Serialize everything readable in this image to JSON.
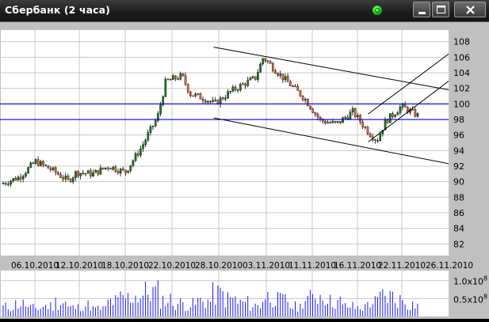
{
  "window": {
    "title": "Сбербанк (2 часа)",
    "status_indicator_color": "#2fd12f",
    "buttons": [
      "minimize-icon",
      "maximize-icon",
      "close-icon"
    ]
  },
  "colors": {
    "plot_background": "#ffffff",
    "panel_background": "#c0c0c0",
    "grid": "#c8c8c8",
    "up_candle": "#1e7b1e",
    "down_candle": "#e8663a",
    "support_lines": "#0000cc",
    "trend_lines": "#000000",
    "volume_bars": "#1a1aff"
  },
  "chart_data": [
    {
      "type": "candlestick",
      "y_axis": {
        "ticks": [
          "82",
          "84",
          "86",
          "88",
          "90",
          "92",
          "94",
          "96",
          "98",
          "100",
          "102",
          "104",
          "106",
          "108"
        ],
        "range": [
          80.5,
          109.5
        ],
        "position": "right"
      },
      "x_axis": {
        "tick_labels": [
          "06.10.2010",
          "12.10.2010",
          "18.10.2010",
          "22.10.2010",
          "28.10.2010",
          "03.11.2010",
          "11.11.2010",
          "16.11.2010",
          "22.11.2010",
          "26.11.2010"
        ]
      },
      "grid": true,
      "horizontal_lines": [
        100.0,
        98.0
      ],
      "close_path_approx": [
        {
          "date": "02.10.2010",
          "close": 89.8
        },
        {
          "date": "04.10.2010",
          "close": 90.6
        },
        {
          "date": "06.10.2010",
          "close": 92.6
        },
        {
          "date": "08.10.2010",
          "close": 91.5
        },
        {
          "date": "10.10.2010",
          "close": 90.1
        },
        {
          "date": "11.10.2010",
          "close": 91.2
        },
        {
          "date": "13.10.2010",
          "close": 91.0
        },
        {
          "date": "15.10.2010",
          "close": 92.0
        },
        {
          "date": "17.10.2010",
          "close": 91.2
        },
        {
          "date": "19.10.2010",
          "close": 94.4
        },
        {
          "date": "20.10.2010",
          "close": 96.4
        },
        {
          "date": "21.10.2010",
          "close": 98.3
        },
        {
          "date": "22.10.2010",
          "close": 102.9
        },
        {
          "date": "24.10.2010",
          "close": 103.6
        },
        {
          "date": "25.10.2010",
          "close": 101.3
        },
        {
          "date": "27.10.2010",
          "close": 100.6
        },
        {
          "date": "28.10.2010",
          "close": 100.0
        },
        {
          "date": "30.10.2010",
          "close": 101.6
        },
        {
          "date": "01.11.2010",
          "close": 102.8
        },
        {
          "date": "02.11.2010",
          "close": 103.3
        },
        {
          "date": "03.11.2010",
          "close": 106.0
        },
        {
          "date": "05.11.2010",
          "close": 103.8
        },
        {
          "date": "08.11.2010",
          "close": 100.8
        },
        {
          "date": "10.11.2010",
          "close": 97.9
        },
        {
          "date": "12.11.2010",
          "close": 97.4
        },
        {
          "date": "14.11.2010",
          "close": 99.0
        },
        {
          "date": "16.11.2010",
          "close": 96.3
        },
        {
          "date": "17.11.2010",
          "close": 95.3
        },
        {
          "date": "18.11.2010",
          "close": 97.7
        },
        {
          "date": "20.11.2010",
          "close": 99.7
        },
        {
          "date": "22.11.2010",
          "close": 98.5
        }
      ],
      "trend_lines": [
        {
          "from": {
            "date": "28.10.2010",
            "price": 107.3
          },
          "to": {
            "date": "26.11.2010",
            "price": 101.8
          }
        },
        {
          "from": {
            "date": "28.10.2010",
            "price": 98.2
          },
          "to": {
            "date": "26.11.2010",
            "price": 92.3
          }
        },
        {
          "from": {
            "date": "16.11.2010",
            "price": 95.1
          },
          "to": {
            "date": "26.11.2010",
            "price": 103.0
          }
        },
        {
          "from": {
            "date": "16.11.2010",
            "price": 98.7
          },
          "to": {
            "date": "26.11.2010",
            "price": 106.5
          }
        }
      ]
    },
    {
      "type": "bar",
      "name": "volume",
      "y_axis": {
        "ticks": [
          {
            "value": 0.5,
            "label": "0.5x10",
            "exp": "8"
          },
          {
            "value": 1.0,
            "label": "1.0x10",
            "exp": "8"
          }
        ],
        "range": [
          0,
          1.28
        ],
        "unit_multiplier": 100000000,
        "position": "right"
      },
      "volume_profile_approx": [
        0.32,
        0.42,
        0.28,
        0.35,
        0.48,
        0.3,
        0.38,
        0.26,
        0.5,
        0.62,
        0.7,
        0.82,
        0.56,
        0.44,
        0.4,
        0.52,
        0.74,
        0.58,
        0.46,
        0.37,
        0.66,
        0.54,
        0.33,
        0.6,
        0.72,
        0.5,
        0.34,
        0.3,
        0.48,
        0.68,
        0.56,
        0.42
      ]
    }
  ]
}
